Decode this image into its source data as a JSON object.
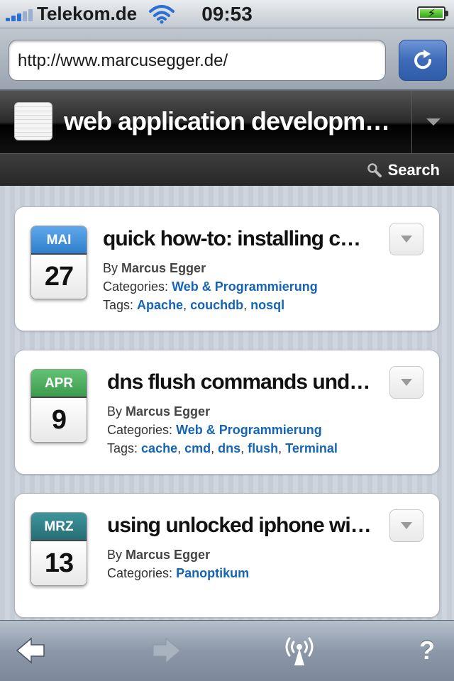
{
  "status_bar": {
    "carrier": "Telekom.de",
    "time": "09:53",
    "signal_icon": "signal-bars-icon",
    "wifi_icon": "wifi-icon",
    "battery_icon": "battery-charging-icon"
  },
  "browser": {
    "url": "http://www.marcusegger.de/",
    "reload_icon": "reload-icon"
  },
  "site": {
    "title": "web application developm…",
    "search_label": "Search"
  },
  "posts": [
    {
      "month": "MAI",
      "day": "27",
      "month_color": "#3e8fd8",
      "title": "quick how-to: installing cou…",
      "by_label": "By",
      "author": "Marcus Egger",
      "categories_label": "Categories:",
      "categories": [
        "Web & Programmierung"
      ],
      "tags_label": "Tags:",
      "tags": [
        "Apache",
        "couchdb",
        "nosql"
      ]
    },
    {
      "month": "APR",
      "day": "9",
      "month_color": "#4aa85a",
      "title": "dns flush commands under …",
      "by_label": "By",
      "author": "Marcus Egger",
      "categories_label": "Categories:",
      "categories": [
        "Web & Programmierung"
      ],
      "tags_label": "Tags:",
      "tags": [
        "cache",
        "cmd",
        "dns",
        "flush",
        "Terminal"
      ]
    },
    {
      "month": "MRZ",
      "day": "13",
      "month_color": "#2e7f87",
      "title": "using unlocked iphone with …",
      "by_label": "By",
      "author": "Marcus Egger",
      "categories_label": "Categories:",
      "categories": [
        "Panoptikum"
      ],
      "tags_label": "",
      "tags": []
    }
  ],
  "toolbar": {
    "back_icon": "back-arrow-icon",
    "forward_icon": "forward-arrow-icon",
    "broadcast_icon": "broadcast-icon",
    "help_label": "?"
  }
}
